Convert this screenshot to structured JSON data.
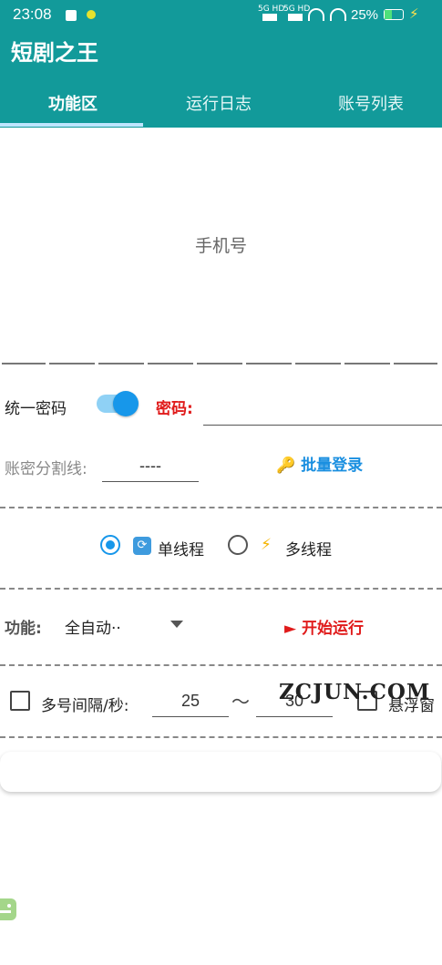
{
  "status_bar": {
    "time": "23:08",
    "network1": "5G HD",
    "network2": "5G HD",
    "battery": "25%"
  },
  "app": {
    "title": "短剧之王"
  },
  "tabs": [
    {
      "label": "功能区",
      "active": true
    },
    {
      "label": "运行日志",
      "active": false
    },
    {
      "label": "账号列表",
      "active": false
    }
  ],
  "phone": {
    "placeholder": "手机号"
  },
  "password_row": {
    "unified_label": "统一密码",
    "unified_on": true,
    "password_label": "密码:",
    "password_value": ""
  },
  "separator_row": {
    "label": "账密分割线:",
    "value": "----",
    "batch_login": "批量登录",
    "batch_icon": "🔑"
  },
  "threads": {
    "single_label": "单线程",
    "single_icon": "🔄",
    "multi_label": "多线程",
    "multi_icon": "⚡",
    "selected": "single"
  },
  "function_row": {
    "label": "功能:",
    "value": "全自动··",
    "start_label": "开始运行",
    "start_icon": "►"
  },
  "interval_row": {
    "label": "多号间隔/秒:",
    "min": "25",
    "tilde": "～",
    "max": "30",
    "float_label": "悬浮窗",
    "watermark": "ZCJUN.COM"
  },
  "colors": {
    "appbar": "#129a9a",
    "accent": "#1797ea",
    "danger": "#e01b1b"
  }
}
